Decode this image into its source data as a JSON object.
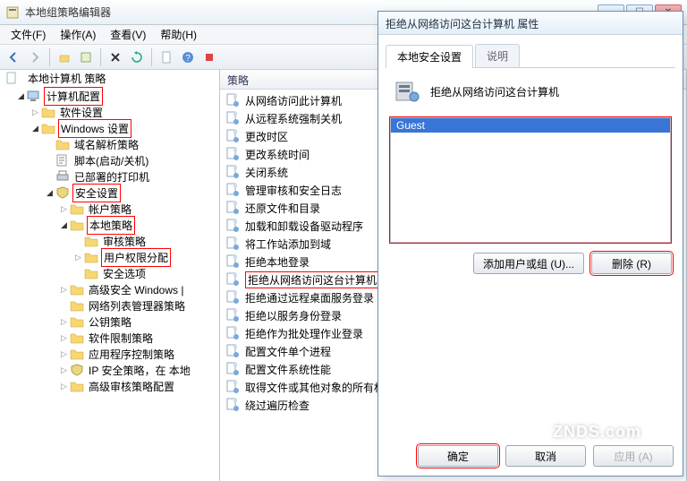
{
  "window": {
    "title": "本地组策略编辑器",
    "wincontrols": {
      "min": "—",
      "max": "☐",
      "close": "✕"
    }
  },
  "menu": {
    "file": "文件(F)",
    "action": "操作(A)",
    "view": "查看(V)",
    "help": "帮助(H)"
  },
  "tree_root": "本地计算机  策略",
  "tree": [
    {
      "indent": 1,
      "exp": "▿",
      "red": true,
      "icon": "comp",
      "label": "计算机配置"
    },
    {
      "indent": 2,
      "exp": "▸",
      "icon": "folder",
      "label": "软件设置"
    },
    {
      "indent": 2,
      "exp": "▿",
      "red": true,
      "icon": "folder",
      "label": "Windows 设置"
    },
    {
      "indent": 3,
      "exp": " ",
      "icon": "folder",
      "label": "域名解析策略"
    },
    {
      "indent": 3,
      "exp": " ",
      "icon": "script",
      "label": "脚本(启动/关机)"
    },
    {
      "indent": 3,
      "exp": " ",
      "icon": "printer",
      "label": "已部署的打印机"
    },
    {
      "indent": 3,
      "exp": "▿",
      "red": true,
      "icon": "shield",
      "label": "安全设置"
    },
    {
      "indent": 4,
      "exp": "▸",
      "icon": "folder",
      "label": "帐户策略"
    },
    {
      "indent": 4,
      "exp": "▿",
      "red": true,
      "icon": "folder",
      "label": "本地策略"
    },
    {
      "indent": 5,
      "exp": " ",
      "icon": "folder",
      "label": "审核策略"
    },
    {
      "indent": 5,
      "exp": "▸",
      "red": true,
      "icon": "folder",
      "label": "用户权限分配"
    },
    {
      "indent": 5,
      "exp": " ",
      "icon": "folder",
      "label": "安全选项"
    },
    {
      "indent": 4,
      "exp": "▸",
      "icon": "folder",
      "label": "高级安全 Windows |"
    },
    {
      "indent": 4,
      "exp": " ",
      "icon": "folder",
      "label": "网络列表管理器策略"
    },
    {
      "indent": 4,
      "exp": "▸",
      "icon": "folder",
      "label": "公钥策略"
    },
    {
      "indent": 4,
      "exp": "▸",
      "icon": "folder",
      "label": "软件限制策略"
    },
    {
      "indent": 4,
      "exp": "▸",
      "icon": "folder",
      "label": "应用程序控制策略"
    },
    {
      "indent": 4,
      "exp": "▸",
      "icon": "shield",
      "label": "IP 安全策略，在 本地"
    },
    {
      "indent": 4,
      "exp": "▸",
      "icon": "folder",
      "label": "高级审核策略配置"
    }
  ],
  "mid": {
    "header": "策略",
    "items": [
      "从网络访问此计算机",
      "从远程系统强制关机",
      "更改时区",
      "更改系统时间",
      "关闭系统",
      "管理审核和安全日志",
      "还原文件和目录",
      "加载和卸载设备驱动程序",
      "将工作站添加到域",
      "拒绝本地登录",
      "拒绝从网络访问这台计算机",
      "拒绝通过远程桌面服务登录",
      "拒绝以服务身份登录",
      "拒绝作为批处理作业登录",
      "配置文件单个进程",
      "配置文件系统性能",
      "取得文件或其他对象的所有权",
      "绕过遍历检查"
    ],
    "selected_index": 10
  },
  "dialog": {
    "title": "拒绝从网络访问这台计算机  属性",
    "tabs": {
      "active": "本地安全设置",
      "other": "说明"
    },
    "policy_name": "拒绝从网络访问这台计算机",
    "list_items": [
      "Guest"
    ],
    "btn_add": "添加用户或组 (U)...",
    "btn_remove": "删除 (R)",
    "btn_ok": "确定",
    "btn_cancel": "取消",
    "btn_apply": "应用 (A)"
  },
  "watermark": "ZNDS.com"
}
